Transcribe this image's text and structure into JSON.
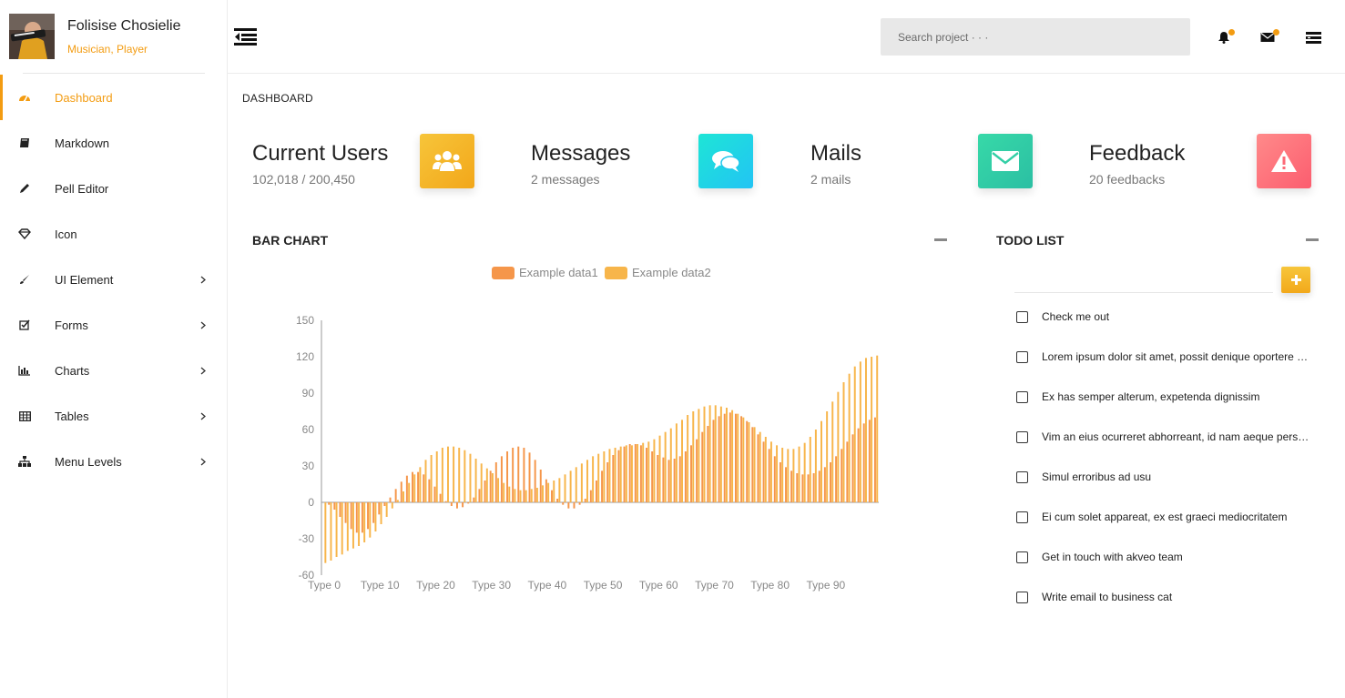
{
  "profile": {
    "name": "Folisise Chosielie",
    "role": "Musician, Player"
  },
  "nav": [
    {
      "label": "Dashboard",
      "icon": "dashboard-icon",
      "active": true,
      "chevron": false
    },
    {
      "label": "Markdown",
      "icon": "book-icon",
      "active": false,
      "chevron": false
    },
    {
      "label": "Pell Editor",
      "icon": "pencil-icon",
      "active": false,
      "chevron": false
    },
    {
      "label": "Icon",
      "icon": "diamond-icon",
      "active": false,
      "chevron": false
    },
    {
      "label": "UI Element",
      "icon": "paintbrush-icon",
      "active": false,
      "chevron": true
    },
    {
      "label": "Forms",
      "icon": "checkbox-icon",
      "active": false,
      "chevron": true
    },
    {
      "label": "Charts",
      "icon": "bar-chart-icon",
      "active": false,
      "chevron": true
    },
    {
      "label": "Tables",
      "icon": "table-icon",
      "active": false,
      "chevron": true
    },
    {
      "label": "Menu Levels",
      "icon": "sitemap-icon",
      "active": false,
      "chevron": true
    }
  ],
  "header": {
    "search_placeholder": "Search project · · ·",
    "icons": [
      "bell-icon",
      "mail-icon",
      "list-icon"
    ]
  },
  "breadcrumb": "DASHBOARD",
  "stats": [
    {
      "title": "Current Users",
      "sub": "102,018 / 200,450",
      "icon": "users-icon",
      "colors": [
        "#f7c53a",
        "#f2a71a"
      ]
    },
    {
      "title": "Messages",
      "sub": "2 messages",
      "icon": "comments-icon",
      "colors": [
        "#1ee5d6",
        "#22c4f4"
      ]
    },
    {
      "title": "Mails",
      "sub": "2 mails",
      "icon": "envelope-icon",
      "colors": [
        "#37d9a8",
        "#2bbfa3"
      ]
    },
    {
      "title": "Feedback",
      "sub": "20 feedbacks",
      "icon": "warning-icon",
      "colors": [
        "#ff8a8a",
        "#fc5d6f"
      ]
    }
  ],
  "bar_panel": {
    "title": "BAR CHART"
  },
  "todo_panel": {
    "title": "TODO LIST"
  },
  "todos": [
    "Check me out",
    "Lorem ipsum dolor sit amet, possit denique oportere at his, etiam corpora deseruisse te pro",
    "Ex has semper alterum, expetenda dignissim",
    "Vim an eius ocurreret abhorreant, id nam aeque persius ornatus.",
    "Simul erroribus ad usu",
    "Ei cum solet appareat, ex est graeci mediocritatem",
    "Get in touch with akveo team",
    "Write email to business cat"
  ],
  "colors": {
    "accent": "#f39c12",
    "data1": "#f5964a",
    "data2": "#f7b54a"
  },
  "chart_data": {
    "type": "bar",
    "legend": [
      "Example data1",
      "Example data2"
    ],
    "ylim": [
      -60,
      150
    ],
    "yticks": [
      150,
      120,
      90,
      60,
      30,
      0,
      -30,
      -60
    ],
    "xtick_labels": [
      "Type 0",
      "Type 10",
      "Type 20",
      "Type 30",
      "Type 40",
      "Type 50",
      "Type 60",
      "Type 70",
      "Type 80",
      "Type 90"
    ],
    "categories_count": 100,
    "series": [
      {
        "name": "Example data1",
        "values": [
          0,
          -2,
          -6,
          -12,
          -17,
          -22,
          -25,
          -25,
          -22,
          -17,
          -10,
          -3,
          4,
          11,
          17,
          22,
          25,
          25,
          23,
          19,
          13,
          7,
          1,
          -3,
          -5,
          -4,
          -1,
          4,
          11,
          18,
          26,
          33,
          38,
          42,
          45,
          46,
          45,
          41,
          35,
          27,
          19,
          10,
          3,
          -2,
          -5,
          -5,
          -2,
          3,
          10,
          18,
          26,
          33,
          39,
          43,
          46,
          48,
          48,
          47,
          45,
          42,
          39,
          37,
          35,
          36,
          38,
          42,
          47,
          52,
          58,
          63,
          68,
          71,
          73,
          74,
          73,
          71,
          67,
          62,
          56,
          50,
          44,
          38,
          33,
          29,
          26,
          24,
          23,
          23,
          24,
          26,
          29,
          33,
          38,
          44,
          50,
          56,
          61,
          65,
          68,
          70
        ]
      },
      {
        "name": "Example data2",
        "values": [
          -50,
          -48,
          -45,
          -43,
          -40,
          -38,
          -36,
          -33,
          -29,
          -24,
          -18,
          -12,
          -5,
          2,
          9,
          16,
          23,
          29,
          35,
          39,
          42,
          45,
          46,
          46,
          45,
          43,
          40,
          36,
          32,
          28,
          24,
          20,
          16,
          13,
          11,
          10,
          10,
          11,
          12,
          14,
          16,
          18,
          20,
          23,
          26,
          29,
          32,
          35,
          38,
          40,
          42,
          44,
          45,
          46,
          47,
          47,
          48,
          49,
          50,
          52,
          55,
          58,
          61,
          65,
          68,
          72,
          75,
          77,
          79,
          80,
          80,
          79,
          78,
          76,
          73,
          70,
          66,
          62,
          58,
          54,
          50,
          47,
          45,
          44,
          44,
          46,
          49,
          54,
          60,
          67,
          75,
          83,
          91,
          99,
          106,
          112,
          116,
          119,
          120,
          121
        ]
      }
    ]
  }
}
